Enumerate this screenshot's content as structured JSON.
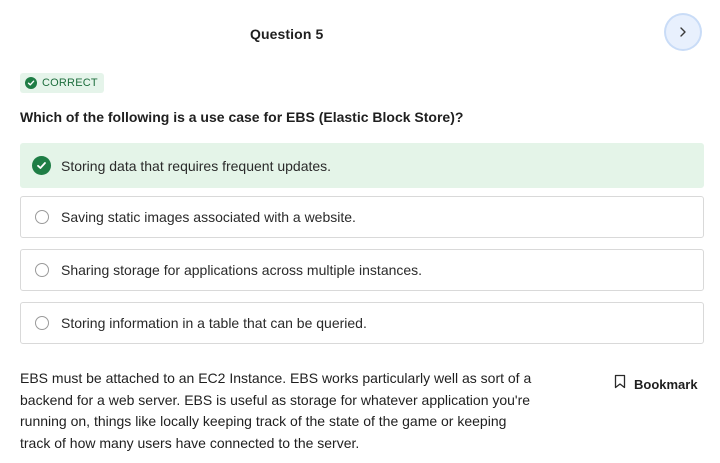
{
  "header": {
    "question_title": "Question 5",
    "next_icon": "chevron-right-icon"
  },
  "result": {
    "badge_label": "CORRECT",
    "badge_icon": "check-circle-icon",
    "color": "#1e7d45"
  },
  "question": {
    "prompt": "Which of the following is a use case for EBS (Elastic Block Store)?",
    "options": [
      {
        "label": "Storing data that requires frequent updates.",
        "state": "selected-correct"
      },
      {
        "label": "Saving static images associated with a website.",
        "state": "unselected"
      },
      {
        "label": "Sharing storage for applications across multiple instances.",
        "state": "unselected"
      },
      {
        "label": "Storing information in a table that can be queried.",
        "state": "unselected"
      }
    ]
  },
  "explanation": {
    "text": "EBS must be attached to an EC2 Instance. EBS works particularly well as sort of a backend for a web server. EBS is useful as storage for whatever application you're running on, things like locally keeping track of the state of the game or keeping track of how many users have connected to the server."
  },
  "bookmark": {
    "label": "Bookmark",
    "icon": "bookmark-icon"
  }
}
